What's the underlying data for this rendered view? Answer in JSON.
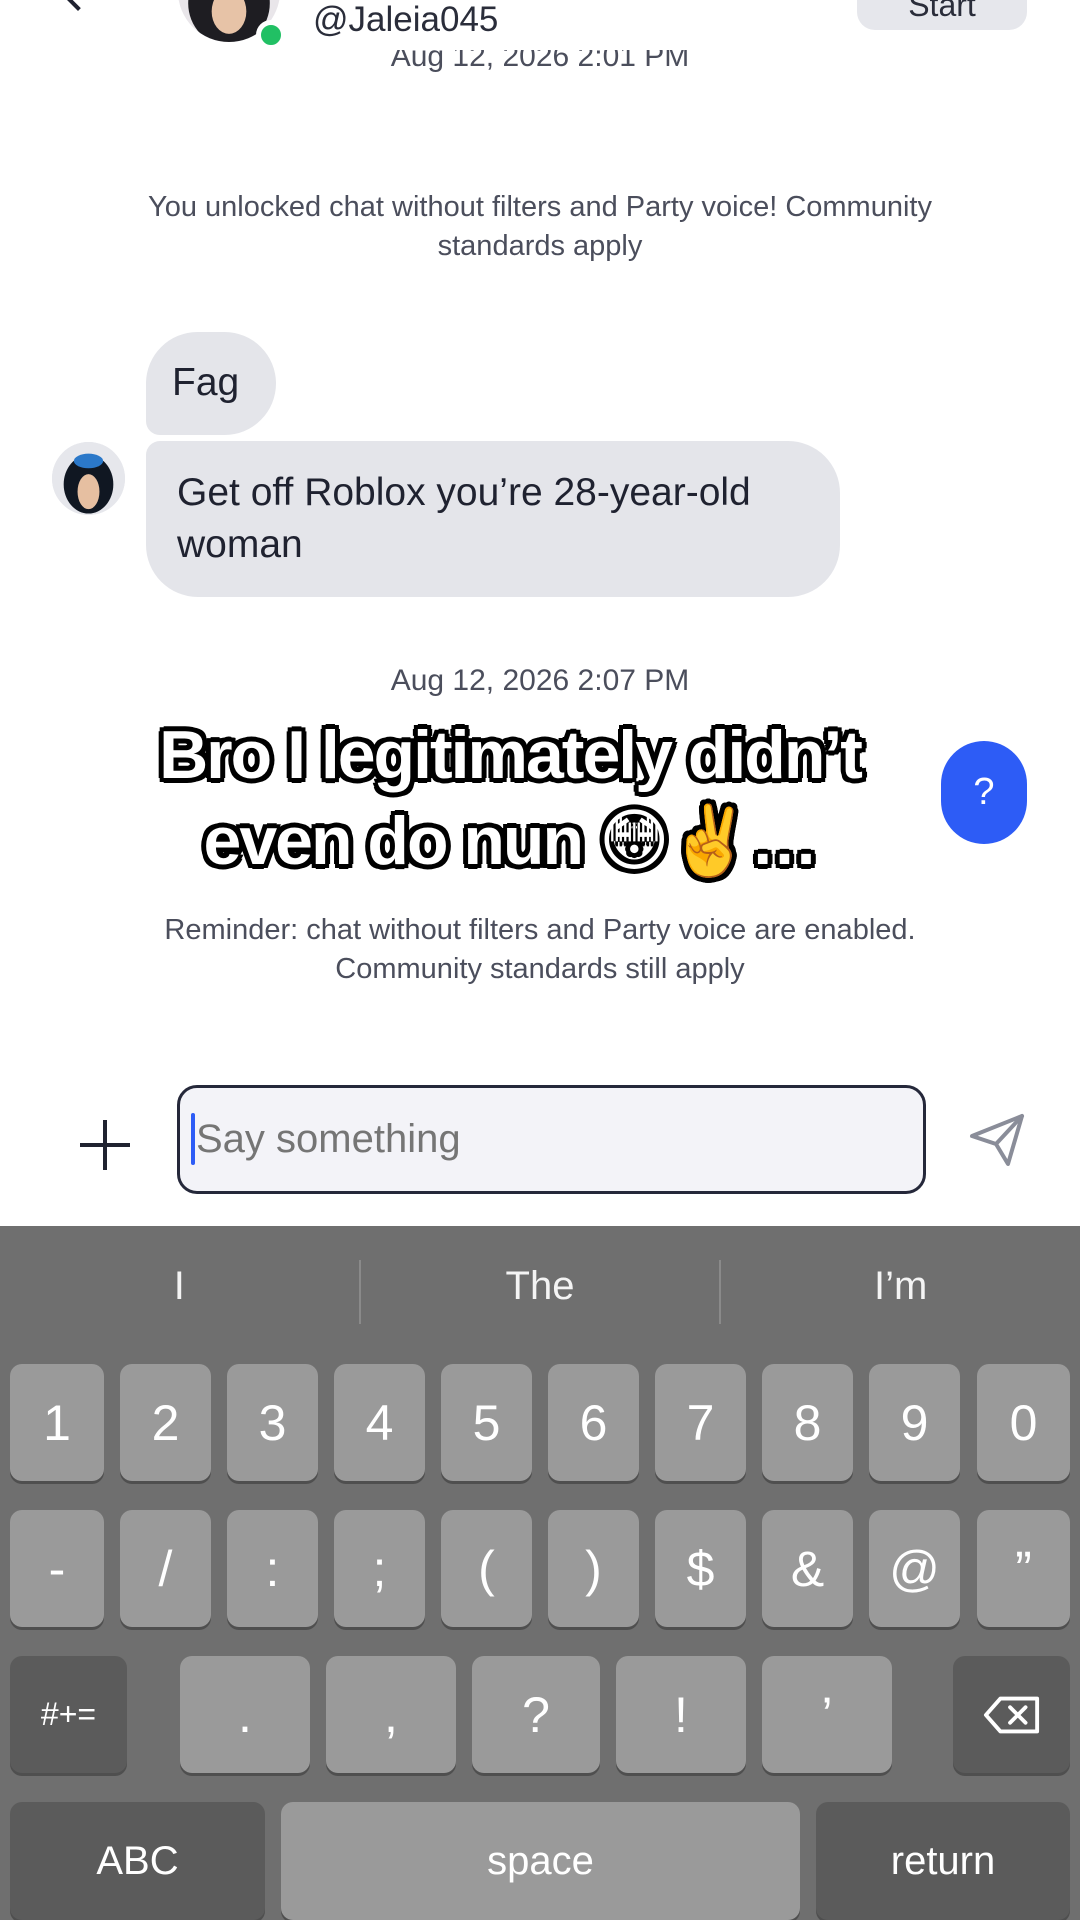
{
  "header": {
    "username": "@Jaleia045",
    "start_button_label": "Start"
  },
  "messages": {
    "timestamp_top": "Aug 12, 2026 2:01 PM",
    "unlock_notice": "You unlocked chat without filters and Party voice! Community standards apply",
    "bubble_1": "Fag",
    "bubble_2": "Get off Roblox you’re 28-year-old woman",
    "timestamp_mid": "Aug 12, 2026 2:07 PM",
    "reminder_notice": "Reminder: chat without filters and Party voice are enabled. Community standards still apply"
  },
  "overlay": {
    "caption": "Bro I legitimately didn’t even do nun 😳✌️…"
  },
  "help_button_label": "?",
  "composer": {
    "placeholder": "Say something"
  },
  "keyboard": {
    "suggestions": [
      "I",
      "The",
      "I’m"
    ],
    "row1": [
      "1",
      "2",
      "3",
      "4",
      "5",
      "6",
      "7",
      "8",
      "9",
      "0"
    ],
    "row2": [
      "-",
      "/",
      ":",
      ";",
      "(",
      ")",
      "$",
      "&",
      "@",
      "”"
    ],
    "row3": [
      "#+=",
      ".",
      ",",
      "?",
      "!",
      "’"
    ],
    "abc_label": "ABC",
    "space_label": "space",
    "return_label": "return",
    "delete_icon": "backspace-icon"
  },
  "colors": {
    "online": "#21c064",
    "accent": "#2d5cf6",
    "bubble": "#e4e5ea",
    "keyboard_bg": "#6f6f6f"
  }
}
